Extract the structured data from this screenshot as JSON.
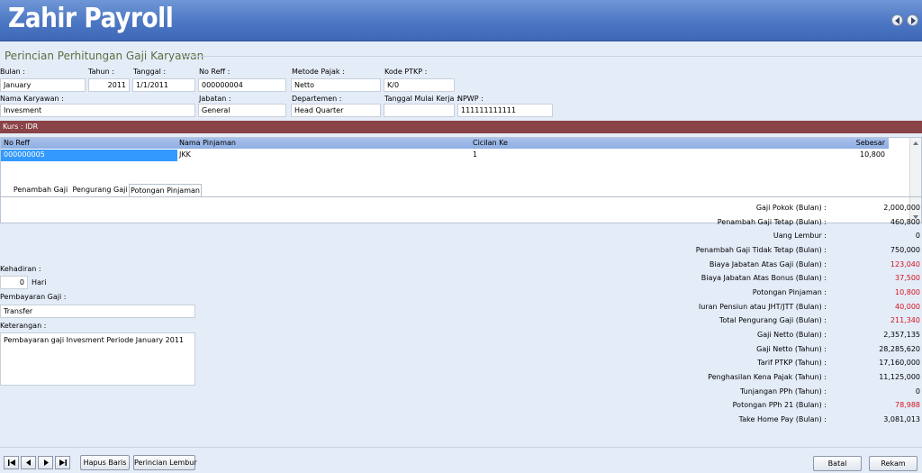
{
  "app": {
    "title": "Zahir Payroll"
  },
  "section_title": "Perincian Perhitungan Gaji Karyawan",
  "form": {
    "bulan": {
      "label": "Bulan :",
      "value": "January"
    },
    "tahun": {
      "label": "Tahun :",
      "value": "2011"
    },
    "tanggal": {
      "label": "Tanggal :",
      "value": "1/1/2011"
    },
    "no_reff": {
      "label": "No Reff :",
      "value": "000000004"
    },
    "metode_pajak": {
      "label": "Metode Pajak :",
      "value": "Netto"
    },
    "kode_ptkp": {
      "label": "Kode PTKP :",
      "value": "K/0"
    },
    "nama_karyawan": {
      "label": "Nama Karyawan :",
      "value": "Invesment"
    },
    "jabatan": {
      "label": "Jabatan :",
      "value": "General"
    },
    "departemen": {
      "label": "Departemen :",
      "value": "Head Quarter"
    },
    "tanggal_mulai_kerja": {
      "label": "Tanggal Mulai Kerja :",
      "value": ""
    },
    "npwp": {
      "label": "NPWP :",
      "value": "111111111111"
    }
  },
  "kurs": "Kurs :  IDR",
  "loan_table": {
    "headers": [
      "No Reff",
      "Nama Pinjaman",
      "Cicilan Ke",
      "Sebesar"
    ],
    "rows": [
      [
        "000000005",
        "JKK",
        "1",
        "10,800"
      ]
    ]
  },
  "tabs": [
    "Penambah Gaji",
    "Pengurang Gaji",
    "Potongan Pinjaman"
  ],
  "left_panel": {
    "kehadiran_label": "Kehadiran :",
    "kehadiran_value": "0",
    "kehadiran_unit": "Hari",
    "pembayaran_label": "Pembayaran Gaji :",
    "pembayaran_value": "Transfer",
    "keterangan_label": "Keterangan :",
    "keterangan_value": "Pembayaran gaji Invesment Periode January 2011"
  },
  "summary": [
    {
      "label": "Gaji Pokok (Bulan) :",
      "value": "2,000,000",
      "color": "#000000"
    },
    {
      "label": "Penambah Gaji Tetap (Bulan) :",
      "value": "460,800",
      "color": "#000000"
    },
    {
      "label": "Uang Lembur :",
      "value": "0",
      "color": "#000000"
    },
    {
      "label": "Penambah Gaji Tidak Tetap (Bulan) :",
      "value": "750,000",
      "color": "#000000"
    },
    {
      "label": "Biaya Jabatan Atas Gaji (Bulan) :",
      "value": "123,040",
      "color": "#d4111b"
    },
    {
      "label": "Biaya Jabatan Atas Bonus (Bulan) :",
      "value": "37,500",
      "color": "#d4111b"
    },
    {
      "label": "Potongan Pinjaman :",
      "value": "10,800",
      "color": "#d4111b"
    },
    {
      "label": "Iuran Pensiun atau JHT/JTT (Bulan) :",
      "value": "40,000",
      "color": "#d4111b"
    },
    {
      "label": "Total Pengurang Gaji (Bulan) :",
      "value": "211,340",
      "color": "#d4111b"
    },
    {
      "label": "Gaji Netto (Bulan) :",
      "value": "2,357,135",
      "color": "#000000"
    },
    {
      "label": "Gaji Netto (Tahun) :",
      "value": "28,285,620",
      "color": "#000000"
    },
    {
      "label": "Tarif PTKP (Tahun) :",
      "value": "17,160,000",
      "color": "#000000"
    },
    {
      "label": "Penghasilan Kena Pajak (Tahun) :",
      "value": "11,125,000",
      "color": "#000000"
    },
    {
      "label": "Tunjangan PPh  (Tahun) :",
      "value": "0",
      "color": "#000000"
    },
    {
      "label": "Potongan PPh 21 (Bulan) :",
      "value": "78,988",
      "color": "#d4111b"
    },
    {
      "label": "Take Home Pay (Bulan) :",
      "value": "3,081,013",
      "color": "#000000"
    }
  ],
  "footer": {
    "hapus_baris": "Hapus Baris",
    "perincian_lembur": "Perincian Lembur",
    "batal": "Batal",
    "rekam": "Rekam"
  },
  "icons": {
    "nav_first": "first-record-icon",
    "nav_prev": "previous-record-icon",
    "nav_next": "next-record-icon",
    "nav_last": "last-record-icon",
    "header_back": "back-arrow-icon",
    "header_forward": "forward-arrow-icon"
  }
}
